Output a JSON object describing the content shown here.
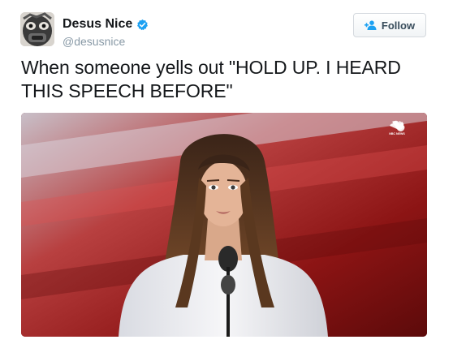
{
  "author": {
    "display_name": "Desus Nice",
    "handle": "@desusnice",
    "verified": true,
    "avatar_icon": "masked-face-avatar"
  },
  "follow_button": {
    "label": "Follow",
    "icon": "add-user-icon"
  },
  "tweet": {
    "text": "When someone yells out \"HOLD UP. I HEARD THIS SPEECH BEFORE\""
  },
  "media": {
    "kind": "video-still",
    "watermark": "NBC NEWS",
    "watermark_icon": "peacock-logo-icon"
  },
  "colors": {
    "accent": "#1da1f2",
    "text": "#14171a",
    "muted": "#8899a6"
  }
}
